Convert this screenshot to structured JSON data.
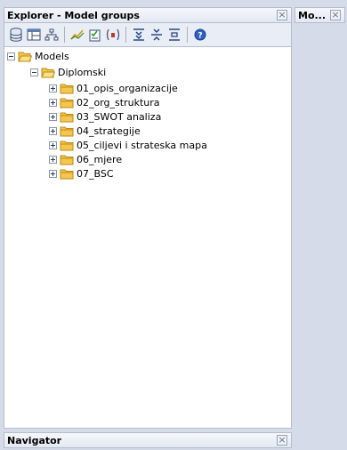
{
  "explorer": {
    "title": "Explorer - Model groups",
    "close_glyph": "×"
  },
  "right_panel": {
    "title": "Mo...",
    "close_glyph": "×"
  },
  "toolbar": {
    "icons": [
      "database-icon",
      "window-icon",
      "hierarchy-icon",
      "chart-icon",
      "checklist-icon",
      "parentheses-icon",
      "expand-all-icon",
      "collapse-all-icon",
      "level-icon",
      "help-icon"
    ]
  },
  "tree": {
    "root": {
      "label": "Models",
      "expanded": true
    },
    "group": {
      "label": "Diplomski",
      "expanded": true
    },
    "items": [
      {
        "label": "01_opis_organizacije"
      },
      {
        "label": "02_org_struktura"
      },
      {
        "label": "03_SWOT analiza"
      },
      {
        "label": "04_strategije"
      },
      {
        "label": "05_ciljevi i strateska mapa"
      },
      {
        "label": "06_mjere"
      },
      {
        "label": "07_BSC"
      }
    ]
  },
  "navigator": {
    "title": "Navigator",
    "close_glyph": "×"
  },
  "colors": {
    "folder_fill": "#f3c64f",
    "folder_stroke": "#c28a12",
    "panel_background": "#d6dbe9"
  }
}
